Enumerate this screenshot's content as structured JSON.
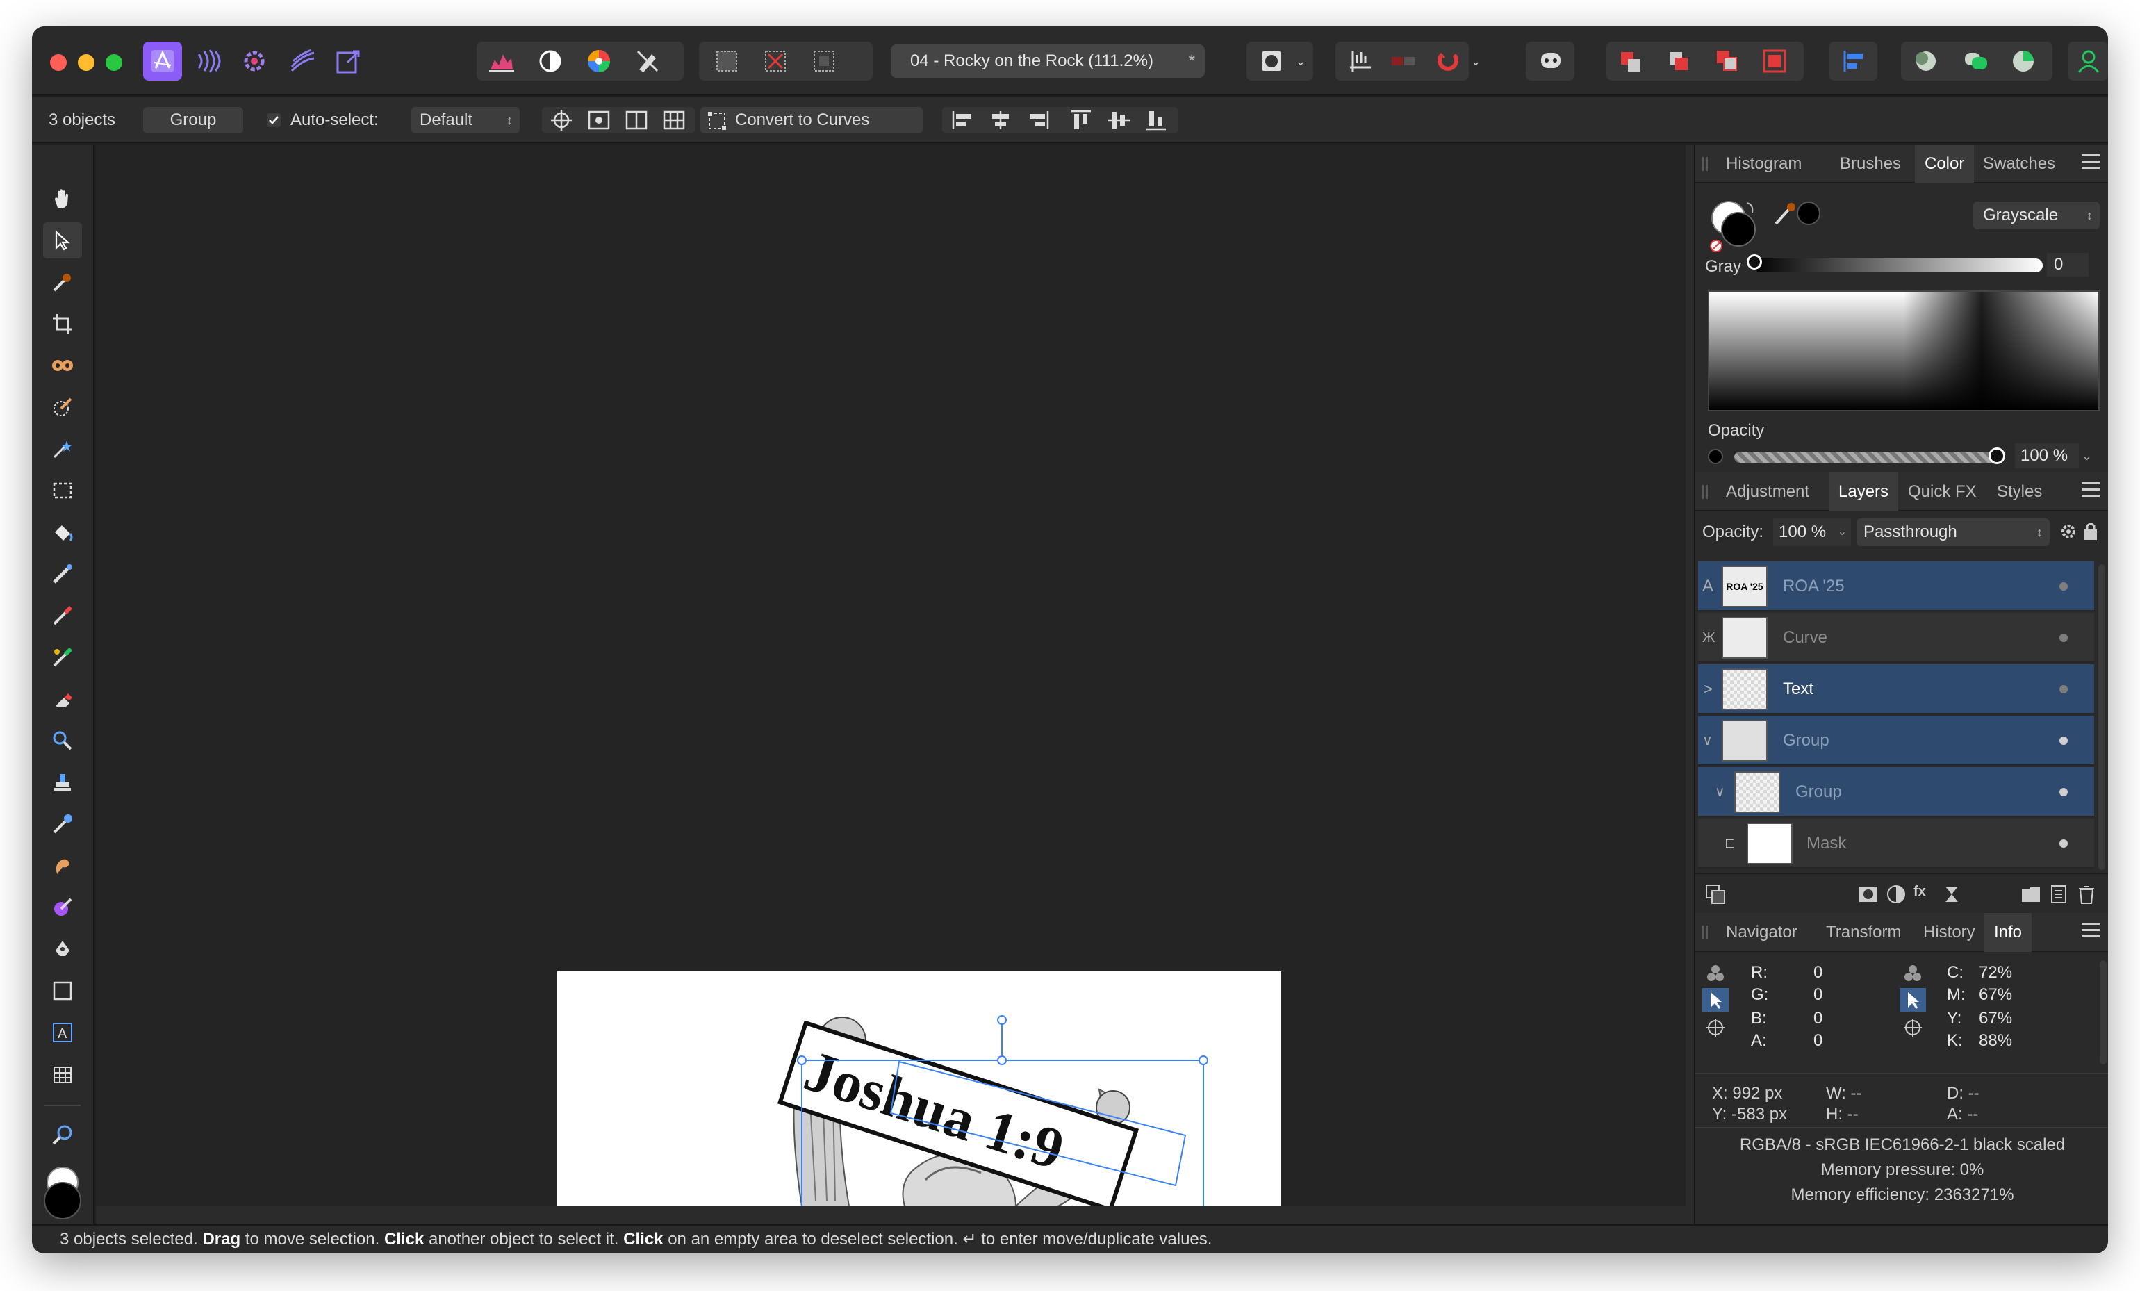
{
  "window": {
    "document_title": "04 - Rocky on the Rock (111.2%)",
    "title_star": "*"
  },
  "context_toolbar": {
    "selection_count": "3 objects",
    "group_button": "Group",
    "auto_select_label": "Auto-select:",
    "auto_select_value": "Default",
    "convert_to_curves": "Convert to Curves"
  },
  "color_panel": {
    "tabs": [
      "Histogram",
      "Brushes",
      "Color",
      "Swatches"
    ],
    "active_tab": "Color",
    "mode": "Grayscale",
    "gray_label": "Gray",
    "gray_value": "0",
    "opacity_label": "Opacity",
    "opacity_value": "100 %"
  },
  "layers_panel": {
    "tabs": [
      "Adjustment",
      "Layers",
      "Quick FX",
      "Styles"
    ],
    "active_tab": "Layers",
    "opacity_label": "Opacity:",
    "opacity_value": "100 %",
    "blend_mode": "Passthrough",
    "layers": [
      {
        "name": "ROA '25",
        "type_glyph": "A",
        "selected": true,
        "thumb_text": "ROA '25"
      },
      {
        "name": "Curve",
        "type_glyph": "Ж",
        "selected": false,
        "thumb_text": ""
      },
      {
        "name": "Text",
        "type_glyph": ">",
        "selected": true,
        "thumb_text": ""
      },
      {
        "name": "Group",
        "type_glyph": "∨",
        "selected": true,
        "thumb_text": ""
      },
      {
        "name": "Group",
        "type_glyph": "∨",
        "selected": true,
        "thumb_text": ""
      },
      {
        "name": "Mask",
        "type_glyph": "□",
        "selected": false,
        "thumb_text": ""
      }
    ]
  },
  "info_panel": {
    "tabs": [
      "Navigator",
      "Transform",
      "History",
      "Info"
    ],
    "active_tab": "Info",
    "rgba": [
      {
        "label": "R:",
        "value": "0"
      },
      {
        "label": "G:",
        "value": "0"
      },
      {
        "label": "B:",
        "value": "0"
      },
      {
        "label": "A:",
        "value": "0"
      }
    ],
    "cmyk": [
      {
        "label": "C:",
        "value": "72%"
      },
      {
        "label": "M:",
        "value": "67%"
      },
      {
        "label": "Y:",
        "value": "67%"
      },
      {
        "label": "K:",
        "value": "88%"
      }
    ],
    "x": "X: 992 px",
    "y": "Y: -583 px",
    "w": "W: --",
    "h": "H: --",
    "d": "D: --",
    "a": "A: --",
    "profile": "RGBA/8 - sRGB IEC61966-2-1 black scaled",
    "memory_pressure": "Memory pressure: 0%",
    "memory_efficiency": "Memory efficiency: 2363271%"
  },
  "canvas": {
    "artwork_text": "Joshua 1:9"
  },
  "status": {
    "count_text": "3 objects selected.",
    "drag": "Drag",
    "drag_text": "to move selection.",
    "click1": "Click",
    "click1_text": "another object to select it.",
    "click2": "Click",
    "click2_text": "on an empty area to deselect selection.",
    "enter_glyph": "↵",
    "enter_text": "to enter move/duplicate values."
  },
  "colors": {
    "accent": "#3b5f8e",
    "selected_row": "#2e4a6e",
    "app_icon": "#8b5cf6"
  },
  "icons": {
    "toolbar": [
      "app-icon",
      "audio-wave-icon",
      "gear-icon",
      "liquify-icon",
      "export-icon",
      "levels-icon",
      "half-circle-icon",
      "color-wheel-icon",
      "brush-off-icon"
    ]
  }
}
